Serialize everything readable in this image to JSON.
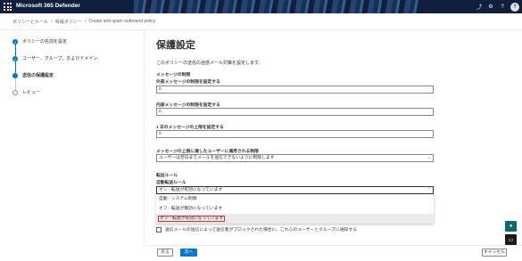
{
  "app": {
    "title": "Microsoft 365 Defender",
    "avatar_initials": "?"
  },
  "breadcrumb": [
    "ポリシーとルール",
    "脅威ポリシー",
    "Create anti-spam outbound policy"
  ],
  "steps": [
    {
      "label": "ポリシーの名前を設定",
      "state": "done"
    },
    {
      "label": "ユーザー、グループ、およびドメイン",
      "state": "done"
    },
    {
      "label": "送信の保護設定",
      "state": "current"
    },
    {
      "label": "レビュー",
      "state": "todo"
    }
  ],
  "main": {
    "title": "保護設定",
    "description": "このポリシーの送信の迷惑メール対策を設定します。",
    "section_limits": "メッセージの制限",
    "external_limit_label": "外部メッセージの制限を設定する",
    "external_limit_value": "0",
    "internal_limit_label": "内部メッセージの制限を設定する",
    "internal_limit_value": "0",
    "daily_limit_label": "1 日のメッセージの上限を設定する",
    "daily_limit_value": "0",
    "restriction_label": "メッセージの上限に達したユーザーに適用される制限",
    "restriction_value": "ユーザーは翌日までメールを送信できないように制限します",
    "section_forwarding": "転送ルール",
    "autoforward_label": "自動転送ルール",
    "autoforward_value": "オン - 転送が有効になっています",
    "checkbox_label": "送信メールの送信によって送信者がブロックされた場合に、これらのユーザーとグループに通知する"
  },
  "dropdown": {
    "options": [
      "自動 - システム制御",
      "オフ - 転送が無効になっています",
      "オン - 転送が有効になっています"
    ],
    "selected_index": 2
  },
  "footer": {
    "back_label": "戻る",
    "next_label": "次へ",
    "cancel_label": "キャンセル"
  }
}
